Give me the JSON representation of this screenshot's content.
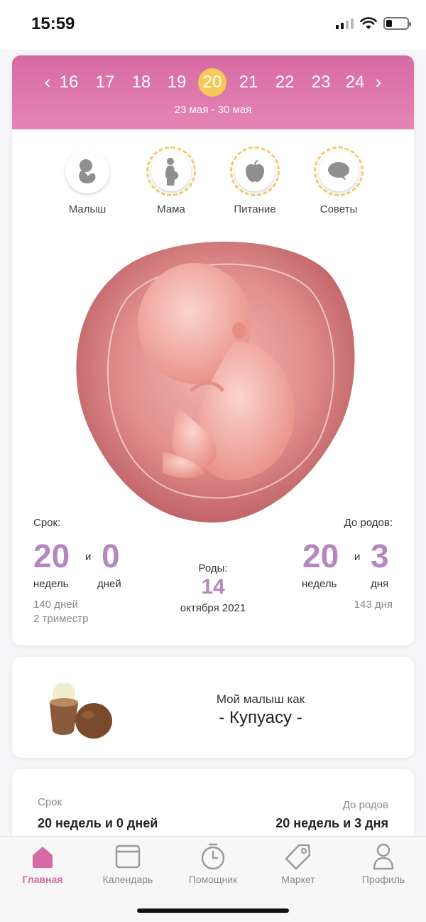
{
  "status_bar": {
    "time": "15:59"
  },
  "week_selector": {
    "weeks": [
      "16",
      "17",
      "18",
      "19",
      "20",
      "21",
      "22",
      "23",
      "24"
    ],
    "selected_week": "20",
    "date_range": "23 мая - 30 мая",
    "header_color": "#d76aa4",
    "selected_color": "#f6c85a"
  },
  "tabs": [
    {
      "label": "Малыш",
      "icon": "baby-icon"
    },
    {
      "label": "Мама",
      "icon": "pregnant-woman-icon"
    },
    {
      "label": "Питание",
      "icon": "apple-icon"
    },
    {
      "label": "Советы",
      "icon": "speech-bubble-icon"
    }
  ],
  "pregnancy": {
    "term_label": "Срок:",
    "term_weeks": "20",
    "term_and": "и",
    "term_days": "0",
    "term_weeks_unit": "недель",
    "term_days_unit": "дней",
    "term_total_days": "140 дней",
    "trimester": "2 триместр",
    "birth_label": "Роды:",
    "birth_day": "14",
    "birth_month_year": "октября 2021",
    "remaining_label": "До родов:",
    "remaining_weeks": "20",
    "remaining_and": "и",
    "remaining_days": "3",
    "remaining_weeks_unit": "недель",
    "remaining_days_unit": "дня",
    "remaining_total_days": "143 дня",
    "accent_color": "#b686bf"
  },
  "fruit": {
    "label": "Мой малыш как",
    "name": "- Купуасу -"
  },
  "summary": {
    "term_label": "Срок",
    "term_value": "20 недель и 0 дней",
    "remaining_label": "До родов",
    "remaining_value": "20 недель и 3 дня"
  },
  "bottom_nav": [
    {
      "label": "Главная",
      "icon": "home-icon",
      "active": true
    },
    {
      "label": "Календарь",
      "icon": "calendar-icon",
      "active": false
    },
    {
      "label": "Помощник",
      "icon": "stopwatch-icon",
      "active": false
    },
    {
      "label": "Маркет",
      "icon": "tag-icon",
      "active": false
    },
    {
      "label": "Профиль",
      "icon": "person-icon",
      "active": false
    }
  ]
}
